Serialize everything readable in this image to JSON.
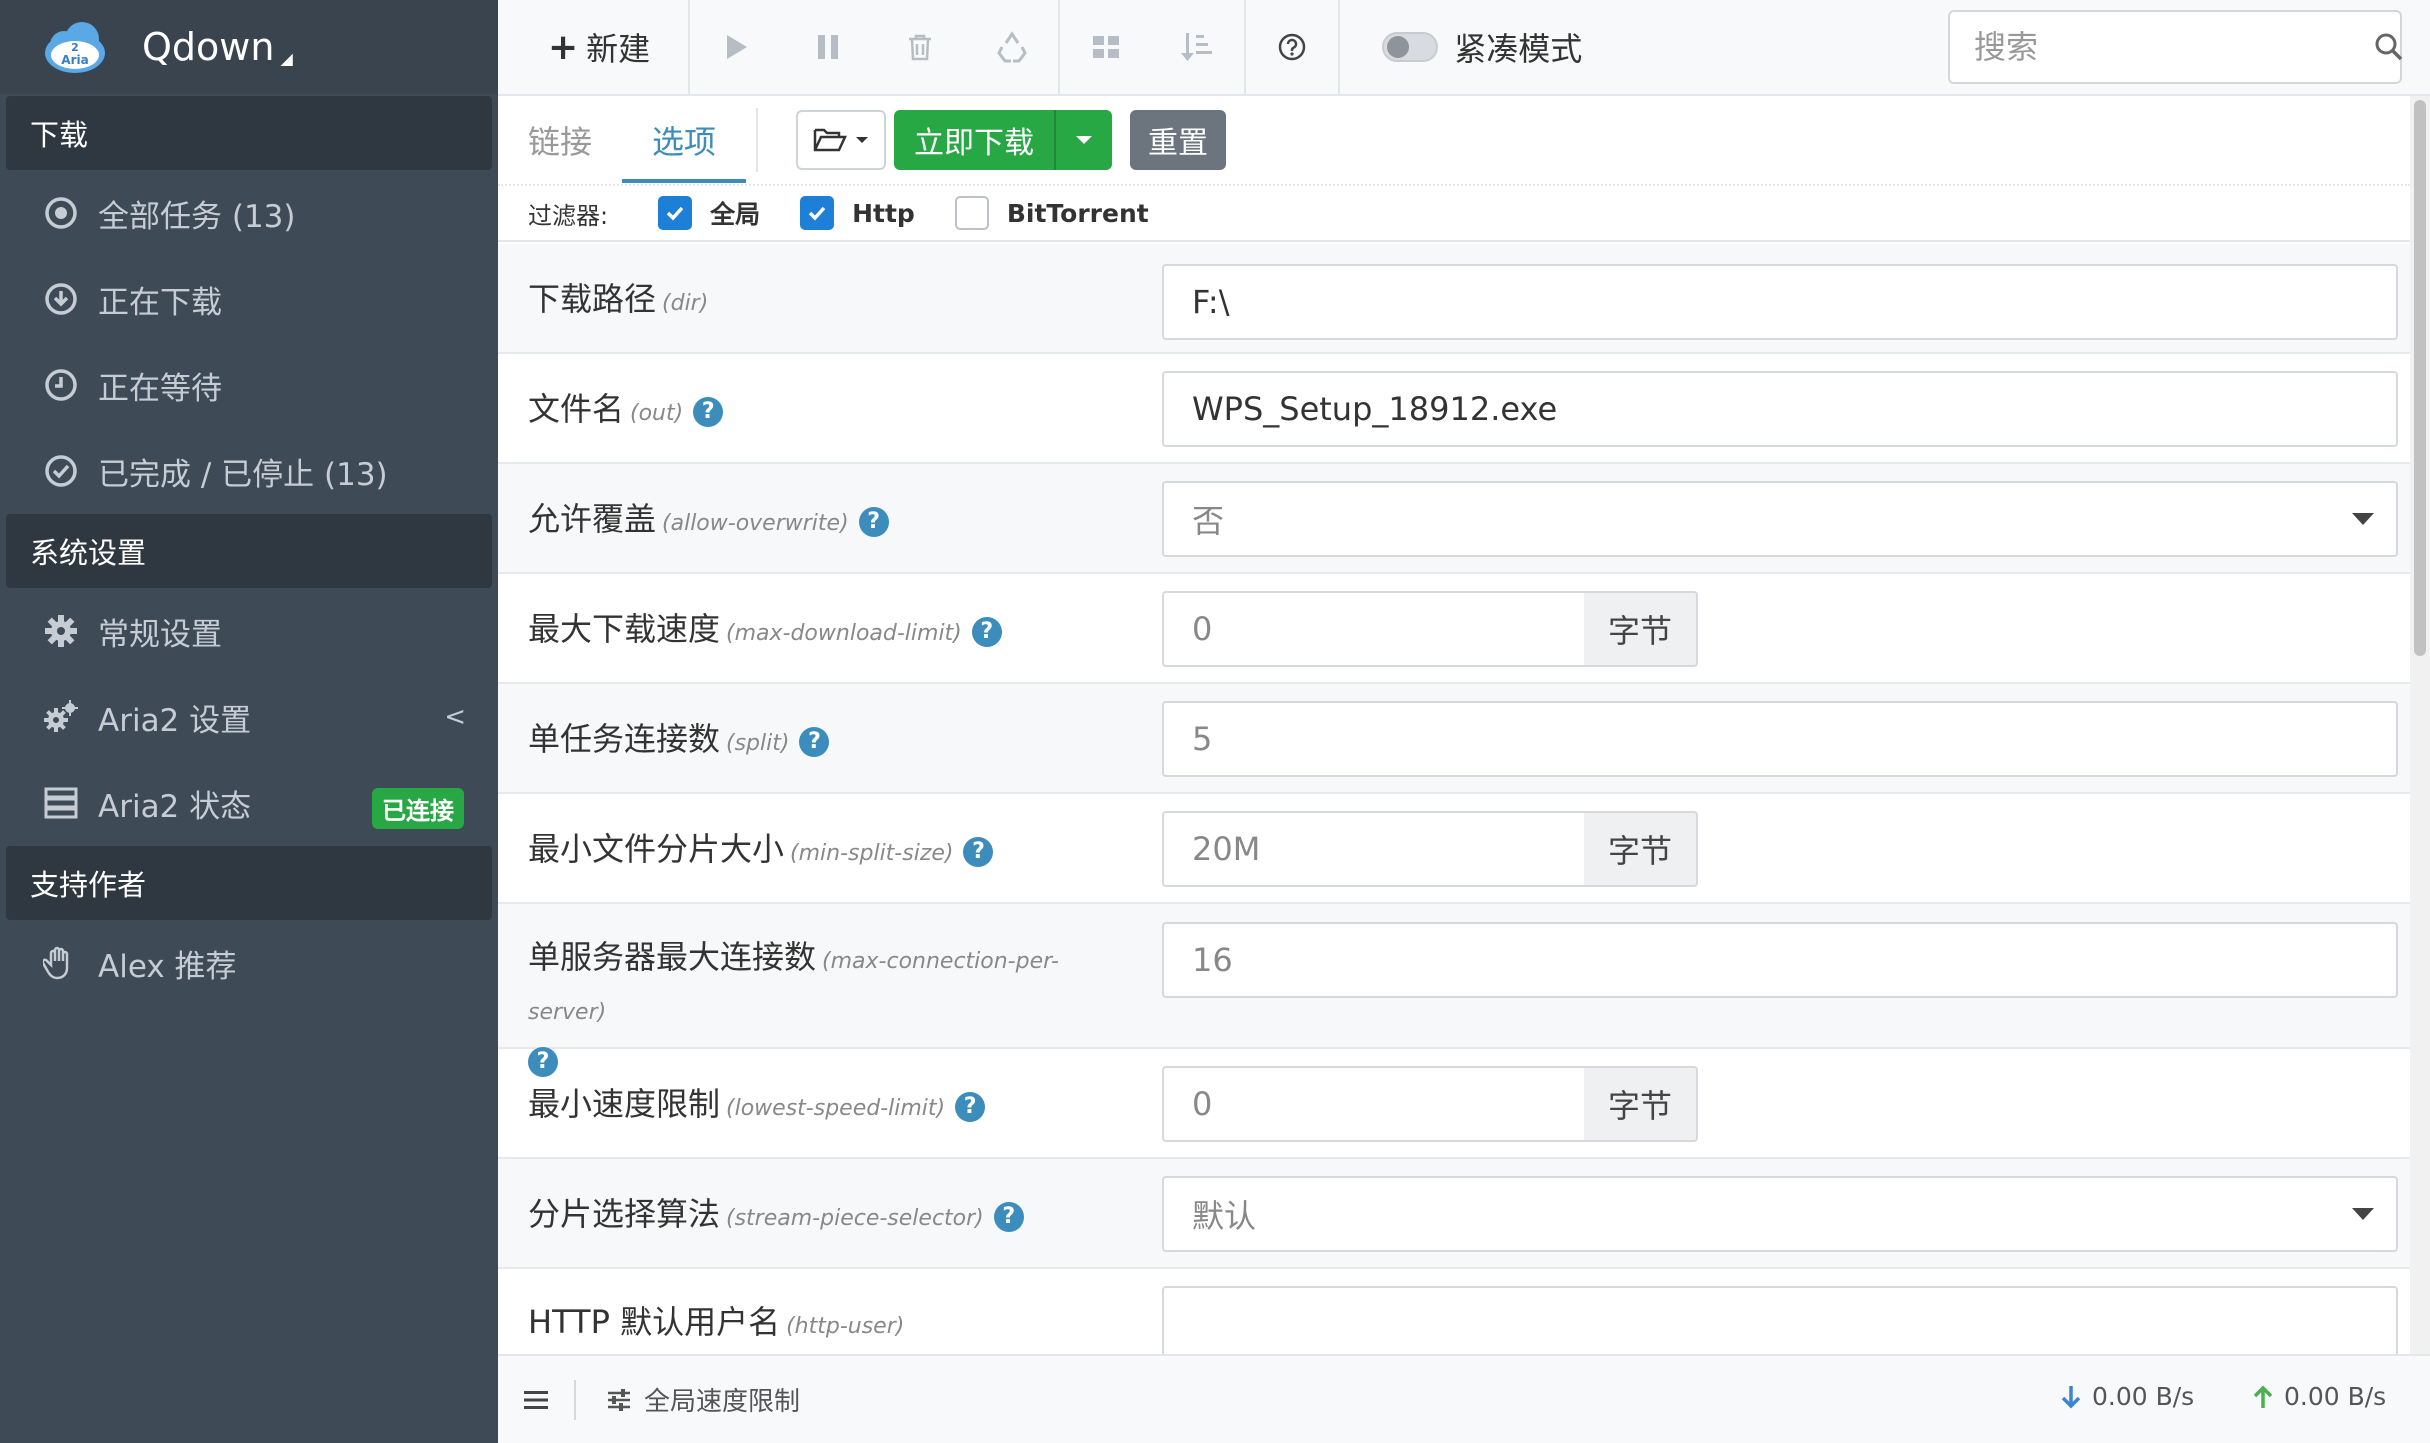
{
  "app": {
    "title": "Qdown",
    "logo_text": "Aria",
    "logo_num": "2"
  },
  "sidebar": {
    "sections": [
      {
        "header": "下载",
        "items": [
          {
            "label": "全部任务 (13)",
            "icon": "target-icon"
          },
          {
            "label": "正在下载",
            "icon": "download-circle-icon"
          },
          {
            "label": "正在等待",
            "icon": "clock-icon"
          },
          {
            "label": "已完成 / 已停止 (13)",
            "icon": "check-circle-icon"
          }
        ]
      },
      {
        "header": "系统设置",
        "items": [
          {
            "label": "常规设置",
            "icon": "gear-icon"
          },
          {
            "label": "Aria2 设置",
            "icon": "gears-icon",
            "chevron": "<"
          },
          {
            "label": "Aria2 状态",
            "icon": "server-icon",
            "badge": "已连接"
          }
        ]
      },
      {
        "header": "支持作者",
        "items": [
          {
            "label": "Alex 推荐",
            "icon": "hand-icon"
          }
        ]
      }
    ]
  },
  "toolbar": {
    "new_label": "新建",
    "compact_mode_label": "紧凑模式",
    "search_placeholder": "搜索"
  },
  "tabs": {
    "items": [
      "链接",
      "选项"
    ],
    "active": "选项",
    "download_now_label": "立即下载",
    "reset_label": "重置"
  },
  "filter": {
    "label": "过滤器:",
    "options": [
      {
        "label": "全局",
        "checked": true
      },
      {
        "label": "Http",
        "checked": true
      },
      {
        "label": "BitTorrent",
        "checked": false
      }
    ]
  },
  "options": [
    {
      "label": "下载路径",
      "key": "(dir)",
      "help": false,
      "value": "F:\\",
      "kind": "text"
    },
    {
      "label": "文件名",
      "key": "(out)",
      "help": true,
      "value": "WPS_Setup_18912.exe",
      "kind": "text"
    },
    {
      "label": "允许覆盖",
      "key": "(allow-overwrite)",
      "help": true,
      "value": "否",
      "kind": "select"
    },
    {
      "label": "最大下载速度",
      "key": "(max-download-limit)",
      "help": true,
      "value": "0",
      "kind": "unit",
      "unit": "字节"
    },
    {
      "label": "单任务连接数",
      "key": "(split)",
      "help": true,
      "value": "5",
      "kind": "text"
    },
    {
      "label": "最小文件分片大小",
      "key": "(min-split-size)",
      "help": true,
      "value": "20M",
      "kind": "unit",
      "unit": "字节"
    },
    {
      "label": "单服务器最大连接数",
      "key": "(max-connection-per-server)",
      "help": true,
      "value": "16",
      "kind": "text"
    },
    {
      "label": "最小速度限制",
      "key": "(lowest-speed-limit)",
      "help": true,
      "value": "0",
      "kind": "unit",
      "unit": "字节"
    },
    {
      "label": "分片选择算法",
      "key": "(stream-piece-selector)",
      "help": true,
      "value": "默认",
      "kind": "select"
    },
    {
      "label": "HTTP 默认用户名",
      "key": "(http-user)",
      "help": false,
      "value": "",
      "kind": "text"
    }
  ],
  "help_glyph": "?",
  "footer": {
    "global_speed_limit_label": "全局速度限制",
    "download_speed": "0.00 B/s",
    "upload_speed": "0.00 B/s"
  },
  "colors": {
    "sidebar_bg": "#3f4a57",
    "accent": "#3c8dbc",
    "success": "#28a745",
    "checkbox": "#1e7fd6"
  }
}
